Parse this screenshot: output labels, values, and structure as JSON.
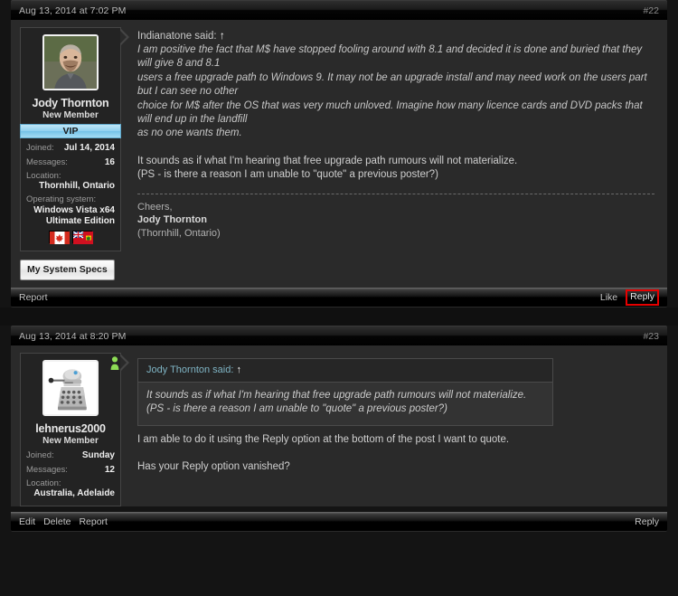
{
  "posts": [
    {
      "date": "Aug 13, 2014 at 7:02 PM",
      "number": "#22",
      "user": {
        "name": "Jody Thornton",
        "title": "New Member",
        "badge": "VIP",
        "joined_label": "Joined:",
        "joined_value": "Jul 14, 2014",
        "messages_label": "Messages:",
        "messages_value": "16",
        "location_label": "Location:",
        "location_value": "Thornhill, Ontario",
        "os_label": "Operating system:",
        "os_value_line1": "Windows Vista x64",
        "os_value_line2": "Ultimate Edition",
        "flags": [
          "canada-flag",
          "ontario-flag"
        ],
        "avatar": "photo-avatar-man"
      },
      "specs_button": "My System Specs",
      "quote_attrib": "Indianatone said:",
      "quote_arrow": "↑",
      "quote_lines": [
        "I am positive the fact that M$ have stopped fooling around with 8.1 and decided it is done and buried that they will give 8 and 8.1",
        "users a free upgrade path to Windows 9. It may not be an upgrade install and may need work on the users part but I can see no other",
        "choice for M$ after the OS that was very much unloved. Imagine how many licence cards and DVD packs that will end up in the landfill",
        "as no one wants them."
      ],
      "message_lines": [
        "It sounds as if what I'm hearing that free upgrade path rumours will not materialize.",
        "(PS - is there a reason I am unable to \"quote\" a previous poster?)"
      ],
      "signature": {
        "line1": "Cheers,",
        "name": "Jody Thornton",
        "line3": "(Thornhill, Ontario)"
      },
      "footer": {
        "left_links": [
          "Report"
        ],
        "right_links": [
          "Like",
          "Reply"
        ],
        "highlighted": "Reply"
      }
    },
    {
      "date": "Aug 13, 2014 at 8:20 PM",
      "number": "#23",
      "user": {
        "name": "lehnerus2000",
        "title": "New Member",
        "joined_label": "Joined:",
        "joined_value": "Sunday",
        "messages_label": "Messages:",
        "messages_value": "12",
        "location_label": "Location:",
        "location_value": "Australia, Adelaide",
        "avatar": "dalek-avatar",
        "online_status": "online-person-icon"
      },
      "quotebox": {
        "attrib": "Jody Thornton said:",
        "arrow": "↑",
        "lines": [
          "It sounds as if what I'm hearing that free upgrade path rumours will not materialize.",
          "(PS - is there a reason I am unable to \"quote\" a previous poster?)"
        ]
      },
      "message_lines": [
        "I am able to do it using the Reply option at the bottom of the post I want to quote.",
        "",
        "Has your Reply option vanished?"
      ],
      "footer": {
        "left_links": [
          "Edit",
          "Delete",
          "Report"
        ],
        "right_links": [
          "Reply"
        ],
        "highlighted": ""
      }
    }
  ],
  "colors": {
    "highlight_box": "#e60000",
    "vip_badge": "#8fd0ef",
    "quote_attrib": "#7fb4c4",
    "page_bg": "#141414"
  }
}
